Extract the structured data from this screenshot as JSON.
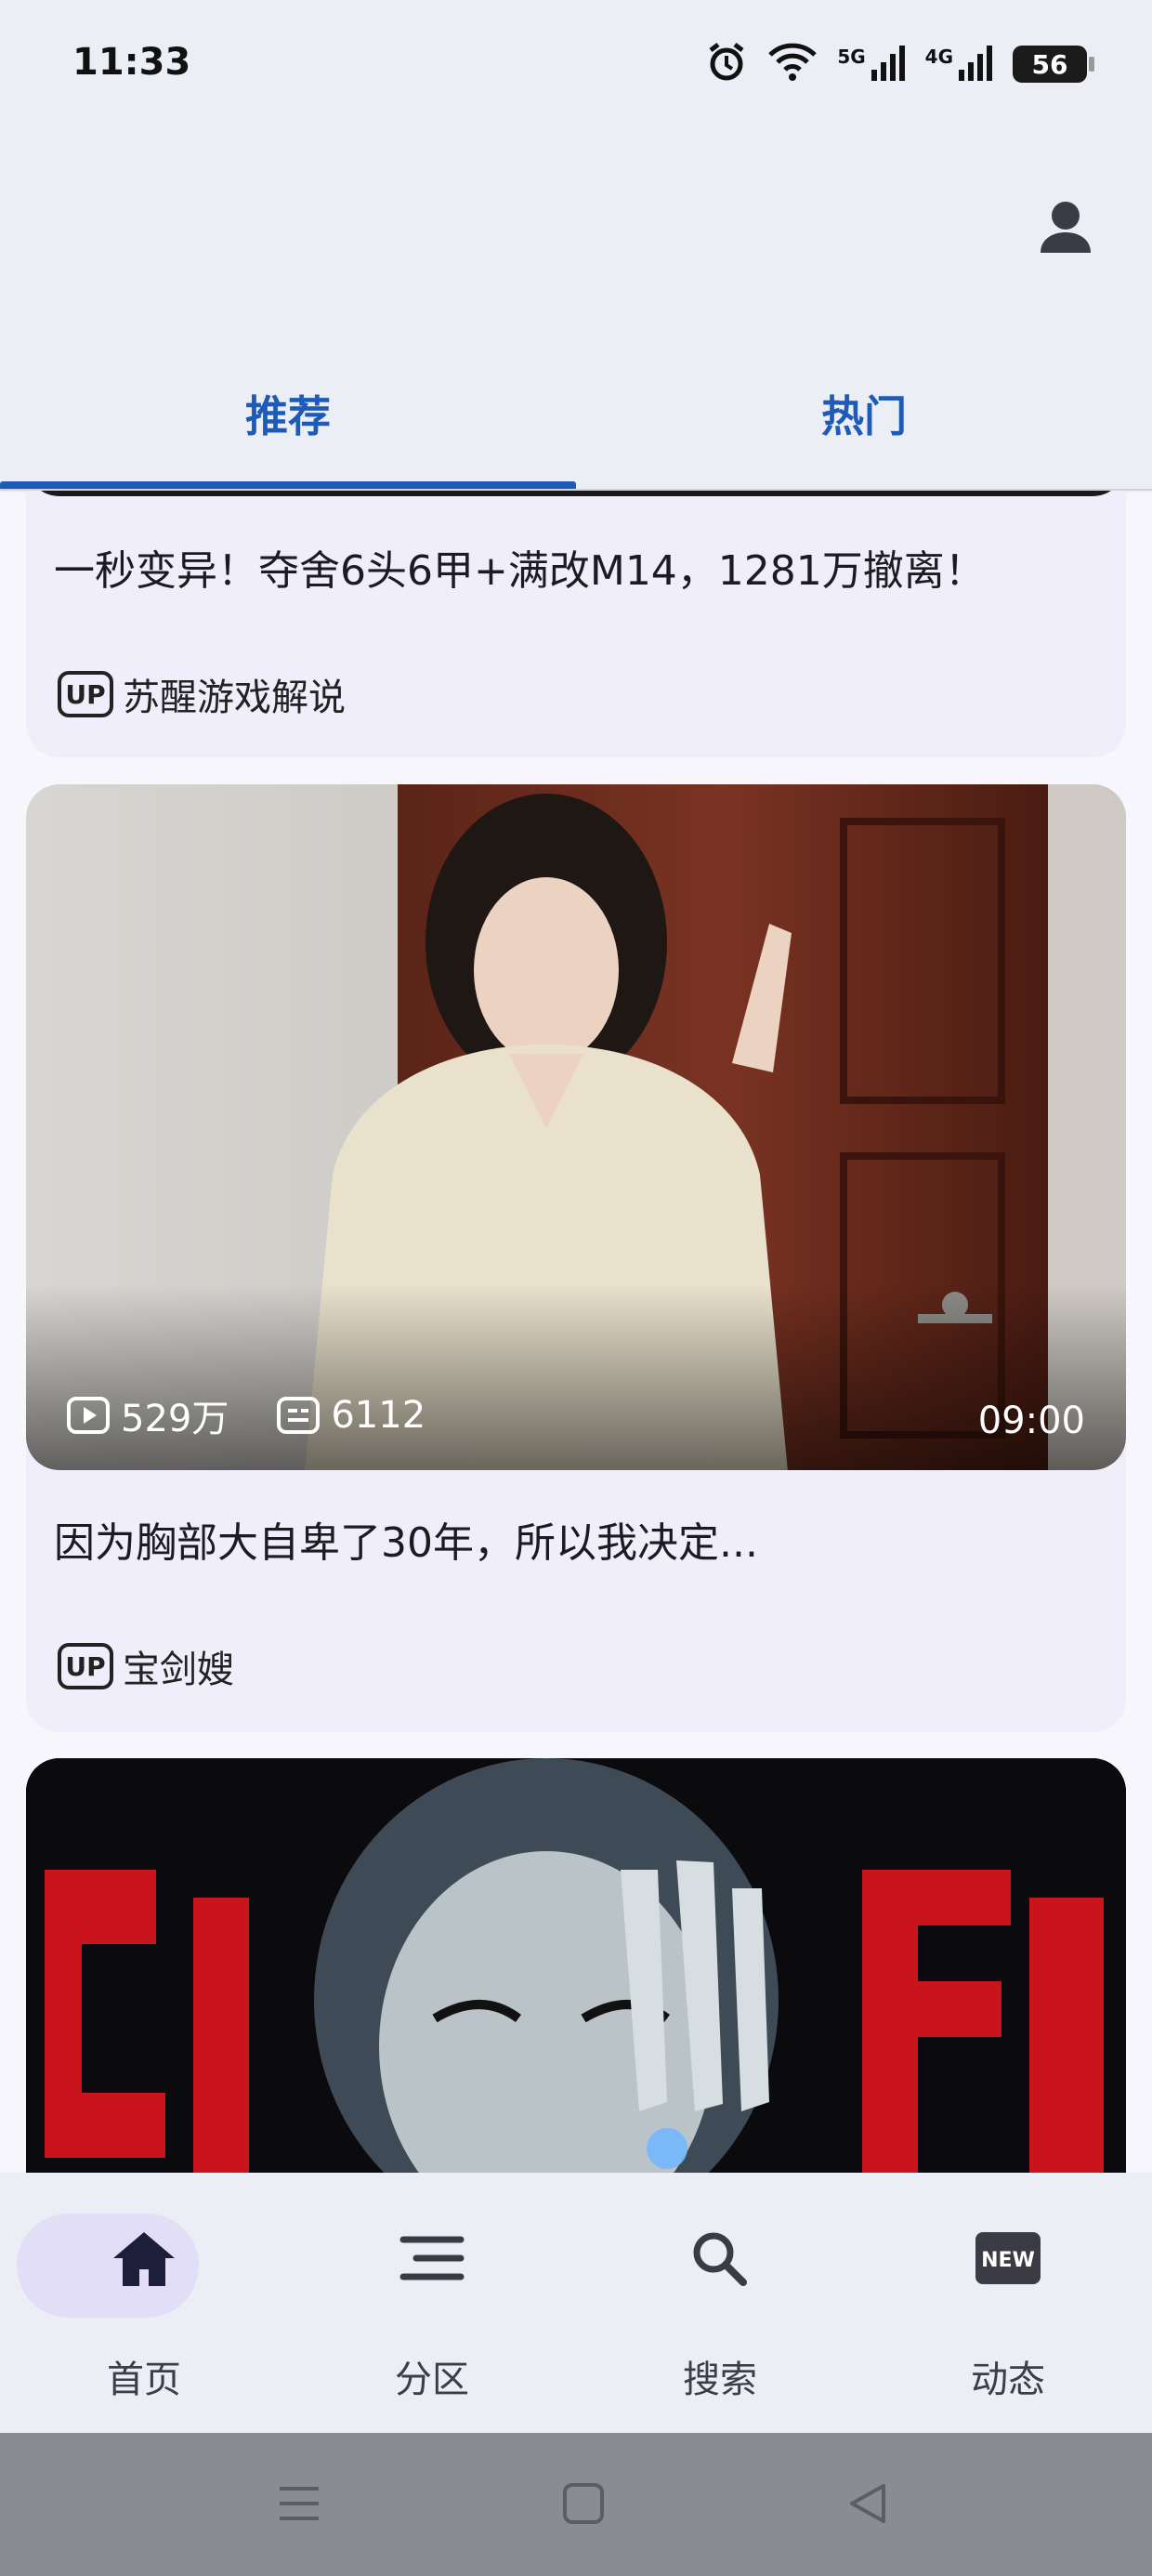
{
  "status_bar": {
    "time": "11:33",
    "signal_5g": "5G",
    "signal_4g": "4G",
    "battery": "56"
  },
  "tabs": [
    {
      "label": "推荐",
      "active": true
    },
    {
      "label": "热门",
      "active": false
    }
  ],
  "feed": {
    "cards": [
      {
        "title": "一秒变异！夺舍6头6甲+满改M14，1281万撤离！",
        "up_badge": "UP",
        "uploader": "苏醒游戏解说"
      },
      {
        "views": "529万",
        "comments": "6112",
        "duration": "09:00",
        "title": "因为胸部大自卑了30年，所以我决定...",
        "up_badge": "UP",
        "uploader": "宝剑嫂"
      },
      {
        "title": "",
        "uploader": ""
      }
    ]
  },
  "bottom_nav": [
    {
      "label": "首页",
      "icon": "home-icon",
      "active": true
    },
    {
      "label": "分区",
      "icon": "menu-icon",
      "active": false
    },
    {
      "label": "搜索",
      "icon": "search-icon",
      "active": false
    },
    {
      "label": "动态",
      "icon": "new-badge-icon",
      "active": false,
      "icon_text": "NEW"
    }
  ],
  "colors": {
    "accent": "#1e5bb8",
    "nav_pill": "#e2def8",
    "background": "#f7f6fc"
  }
}
